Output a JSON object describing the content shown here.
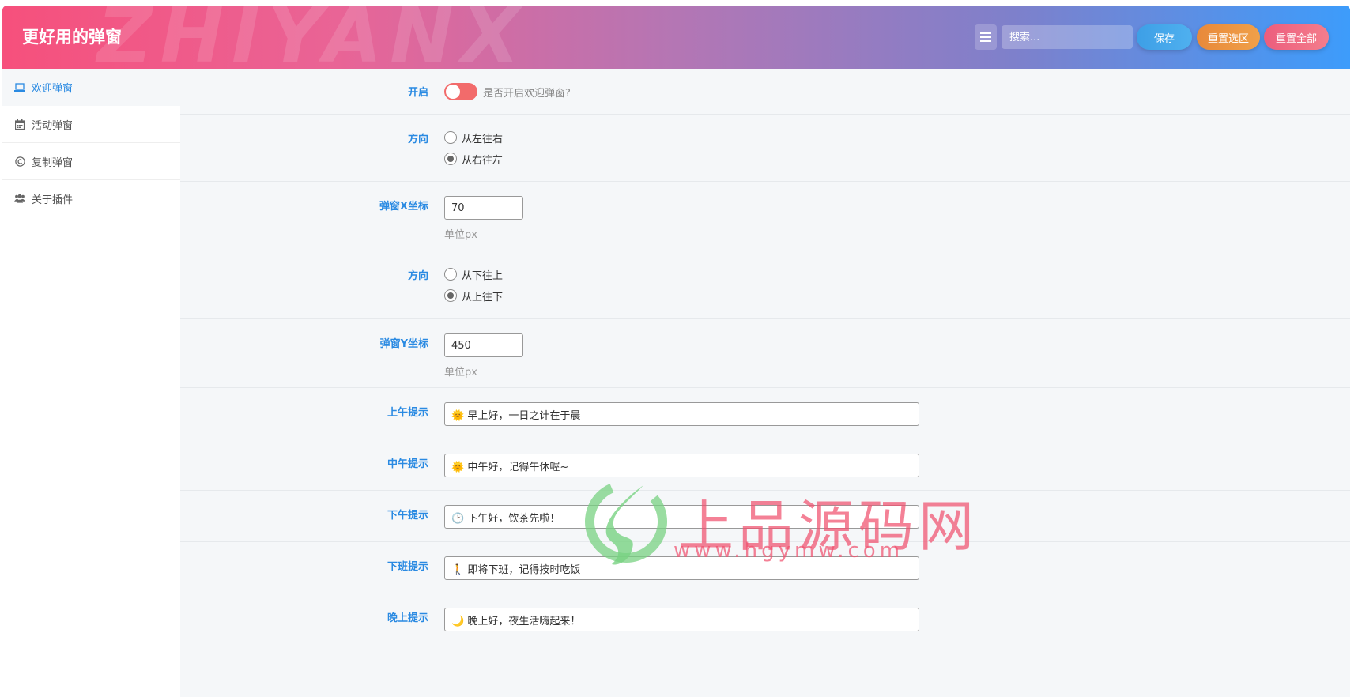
{
  "header": {
    "title": "更好用的弹窗",
    "watermark": "ZHIYANX",
    "search_placeholder": "搜索...",
    "save_label": "保存",
    "reset_selection_label": "重置选区",
    "reset_all_label": "重置全部"
  },
  "sidebar": {
    "items": [
      {
        "label": "欢迎弹窗",
        "icon": "laptop-icon",
        "active": true
      },
      {
        "label": "活动弹窗",
        "icon": "calendar-icon",
        "active": false
      },
      {
        "label": "复制弹窗",
        "icon": "copyright-icon",
        "active": false
      },
      {
        "label": "关于插件",
        "icon": "users-icon",
        "active": false
      }
    ]
  },
  "form": {
    "enable": {
      "label": "开启",
      "description": "是否开启欢迎弹窗?",
      "value": false
    },
    "direction_x": {
      "label": "方向",
      "options": [
        "从左往右",
        "从右往左"
      ],
      "selected": "从右往左"
    },
    "x_coord": {
      "label": "弹窗X坐标",
      "value": "70",
      "unit": "单位px"
    },
    "direction_y": {
      "label": "方向",
      "options": [
        "从下往上",
        "从上往下"
      ],
      "selected": "从上往下"
    },
    "y_coord": {
      "label": "弹窗Y坐标",
      "value": "450",
      "unit": "单位px"
    },
    "morning": {
      "label": "上午提示",
      "value": "🌞 早上好，一日之计在于晨"
    },
    "noon": {
      "label": "中午提示",
      "value": "🌞 中午好，记得午休喔~"
    },
    "afternoon": {
      "label": "下午提示",
      "value": "🕑 下午好，饮茶先啦！"
    },
    "off_work": {
      "label": "下班提示",
      "value": "🚶 即将下班，记得按时吃饭"
    },
    "evening": {
      "label": "晚上提示",
      "value": "🌙 晚上好，夜生活嗨起来！"
    }
  },
  "overlay": {
    "brand_name": "上品源码网",
    "brand_url": "www.hgymw.com"
  },
  "colors": {
    "accent": "#2a8ae2",
    "switch_off": "#f26b6b",
    "header_start": "#f6507c",
    "header_end": "#3d9cfb"
  }
}
